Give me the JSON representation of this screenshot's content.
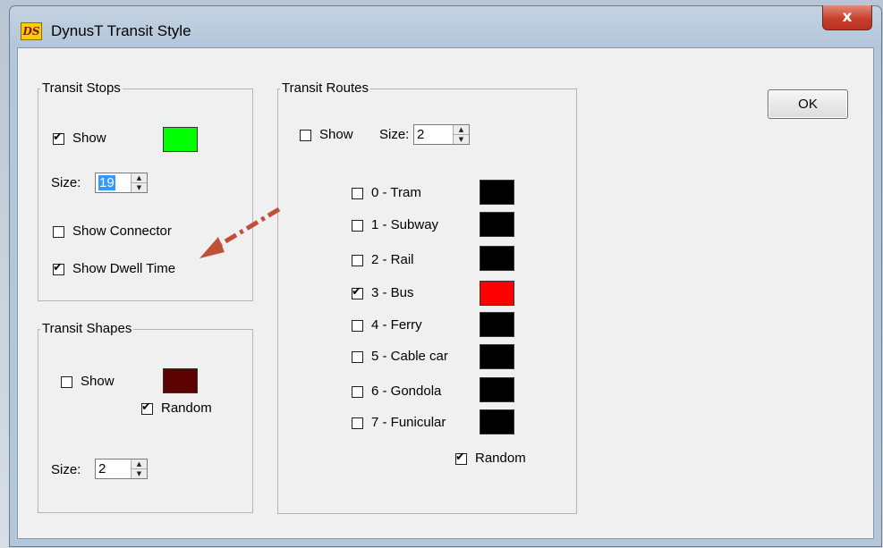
{
  "window": {
    "title": "DynusT Transit Style",
    "icon_text": "DS",
    "close_glyph": "x"
  },
  "ok_button": {
    "label": "OK"
  },
  "transit_stops": {
    "title": "Transit Stops",
    "show": {
      "label": "Show",
      "checked": true
    },
    "color": "#00ff00",
    "size_label": "Size:",
    "size_value": "19",
    "show_connector": {
      "label": "Show Connector",
      "checked": false
    },
    "show_dwell_time": {
      "label": "Show Dwell Time",
      "checked": true
    }
  },
  "transit_shapes": {
    "title": "Transit Shapes",
    "show": {
      "label": "Show",
      "checked": false
    },
    "color": "#5c0000",
    "random": {
      "label": "Random",
      "checked": true
    },
    "size_label": "Size:",
    "size_value": "2"
  },
  "transit_routes": {
    "title": "Transit Routes",
    "show": {
      "label": "Show",
      "checked": false
    },
    "size_label": "Size:",
    "size_value": "2",
    "routes": [
      {
        "label": "0 - Tram",
        "checked": false,
        "color": "#000000"
      },
      {
        "label": "1 - Subway",
        "checked": false,
        "color": "#000000"
      },
      {
        "label": "2 - Rail",
        "checked": false,
        "color": "#000000"
      },
      {
        "label": "3 - Bus",
        "checked": true,
        "color": "#ff0000"
      },
      {
        "label": "4 - Ferry",
        "checked": false,
        "color": "#000000"
      },
      {
        "label": "5 - Cable car",
        "checked": false,
        "color": "#000000"
      },
      {
        "label": "6 - Gondola",
        "checked": false,
        "color": "#000000"
      },
      {
        "label": "7 - Funicular",
        "checked": false,
        "color": "#000000"
      }
    ],
    "random": {
      "label": "Random",
      "checked": true
    }
  },
  "annotation": {
    "arrow_color": "#c0503a"
  }
}
